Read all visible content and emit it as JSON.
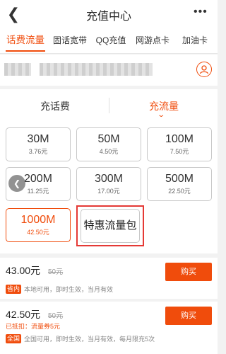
{
  "header": {
    "title": "充值中心",
    "back_icon": "back-arrow-icon",
    "more_icon": "more-dots-icon"
  },
  "tabs": [
    {
      "label": "话费流量",
      "active": true
    },
    {
      "label": "固话宽带",
      "active": false
    },
    {
      "label": "QQ充值",
      "active": false
    },
    {
      "label": "网游点卡",
      "active": false
    },
    {
      "label": "加油卡",
      "active": false
    }
  ],
  "account": {
    "contacts_icon": "user-icon"
  },
  "subtabs": {
    "left": "充话费",
    "right": "充流量",
    "right_active": true
  },
  "packages": [
    {
      "amount": "30M",
      "price": "3.76元"
    },
    {
      "amount": "50M",
      "price": "4.50元"
    },
    {
      "amount": "100M",
      "price": "7.50元"
    },
    {
      "amount": "200M",
      "price": "11.25元"
    },
    {
      "amount": "300M",
      "price": "17.00元"
    },
    {
      "amount": "500M",
      "price": "22.50元"
    },
    {
      "amount": "1000M",
      "price": "42.50元",
      "selected": true
    }
  ],
  "promo": {
    "label": "特惠流量包"
  },
  "offers": [
    {
      "price": "43.00元",
      "original": "50元",
      "buy_label": "购买",
      "badge": "省内",
      "badge_color": "#f04c0c",
      "note": "本地可用，即时生效，当月有效"
    },
    {
      "price": "42.50元",
      "original": "50元",
      "buy_label": "购买",
      "hint": "已抵扣：流量券5元",
      "badge": "全国",
      "badge_color": "#f04c0c",
      "note": "全国可用，即时生效，当月有效，每月限充5次"
    }
  ],
  "colors": {
    "accent": "#f04c0c",
    "highlight_border": "#e53935"
  }
}
